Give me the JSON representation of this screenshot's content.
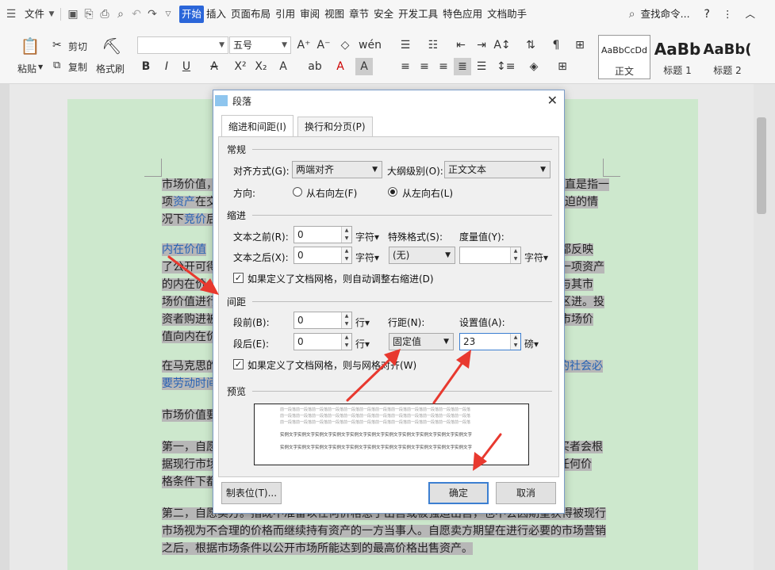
{
  "menubar": {
    "file_menu": "文件",
    "tabs": [
      "开始",
      "插入",
      "页面布局",
      "引用",
      "审阅",
      "视图",
      "章节",
      "安全",
      "开发工具",
      "特色应用",
      "文档助手"
    ],
    "active_tab": "开始",
    "search": "查找命令...",
    "help": "?",
    "more": "⋮",
    "collapse": "︿"
  },
  "ribbon": {
    "paste": "粘贴",
    "cut": "剪切",
    "copy": "复制",
    "format_painter": "格式刷",
    "font_name": "",
    "font_size": "五号",
    "styles": [
      {
        "sample": "AaBbCcDd",
        "label": "正文"
      },
      {
        "sample": "AaBb",
        "label": "标题 1"
      },
      {
        "sample": "AaBb(",
        "label": "标题 2"
      }
    ]
  },
  "document": {
    "p1": [
      "市场价值，",
      "项",
      "资产",
      "在交",
      "况下",
      "竞价",
      "后"
    ],
    "p1_right": [
      "直是指一",
      "迫的情"
    ],
    "p2_link": "内在价值",
    "p2": [
      "了公开可得",
      "的内在价",
      "场价值进行",
      "资者购进被",
      "值向内在价"
    ],
    "p2_right": [
      "都反映",
      "一项资产",
      "与其市",
      "区进。投",
      "市场价"
    ],
    "p3": "在马克思的",
    "p3_right": "的社会必",
    "p3_line2": "要劳动时间",
    "p4": "市场价值要",
    "p5": [
      "第一，自愿",
      "据现行市场",
      "格条件下都"
    ],
    "p5_right": [
      "买者会根",
      "任何价"
    ],
    "p6": [
      "第二，自愿卖方。指既不准备以任何价格急于出售或被强迫出售，也不会因期望获得被现行",
      "市场视为不合理的价格而继续持有资产的一方当事人。自愿卖方期望在进行必要的市场营销",
      "之后，根据市场条件以公开市场所能达到的最高价格出售资产。"
    ]
  },
  "dialog": {
    "title": "段落",
    "tab_indent": "缩进和间距(I)",
    "tab_breaks": "换行和分页(P)",
    "general": "常规",
    "alignment_label": "对齐方式(G):",
    "alignment_value": "两端对齐",
    "outline_label": "大纲级别(O):",
    "outline_value": "正文文本",
    "direction_label": "方向:",
    "rtl": "从右向左(F)",
    "ltr": "从左向右(L)",
    "indent": "缩进",
    "before_text_label": "文本之前(R):",
    "before_text_value": "0",
    "after_text_label": "文本之后(X):",
    "after_text_value": "0",
    "char_unit": "字符▾",
    "special_label": "特殊格式(S):",
    "special_value": "(无)",
    "measure_label": "度量值(Y):",
    "measure_value": "",
    "auto_indent": "如果定义了文档网格，则自动调整右缩进(D)",
    "spacing": "间距",
    "before_label": "段前(B):",
    "before_value": "0",
    "after_label": "段后(E):",
    "after_value": "0",
    "line_unit": "行▾",
    "line_spacing_label": "行距(N):",
    "line_spacing_value": "固定值",
    "set_value_label": "设置值(A):",
    "set_value": "23",
    "pt_unit": "磅▾",
    "snap_grid": "如果定义了文档网格，则与网格对齐(W)",
    "preview": "预览",
    "preview_gray": "前一段落前一段落前一段落前一段落前一段落前一段落前一段落前一段落前一段落前一段落前一段落前一段落",
    "preview_dark": "实例文字实例文字实例文字实例文字实例文字实例文字实例文字实例文字实例文字实例文字实例文字",
    "tabs_button": "制表位(T)...",
    "ok": "确定",
    "cancel": "取消"
  },
  "colors": {
    "accent": "#2b66d9",
    "page": "#cde8cd",
    "arrow": "#e8392f"
  }
}
